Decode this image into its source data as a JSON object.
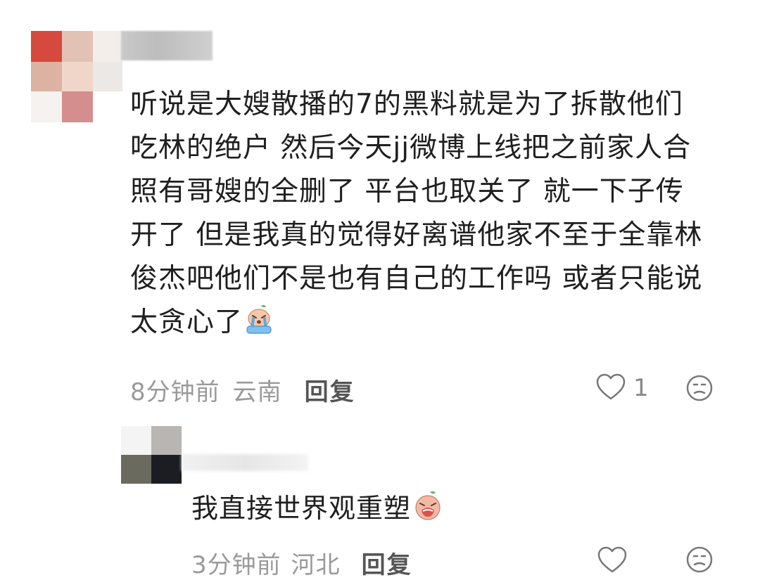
{
  "comments": [
    {
      "lines": [
        "听说是大嫂散播的7的黑料就是为了拆散他们",
        "吃林的绝户 然后今天jj微博上线把之前家人合",
        "照有哥嫂的全删了 平台也取关了 就一下子传",
        "开了 但是我真的觉得好离谱他家不至于全靠林",
        "俊杰吧他们不是也有自己的工作吗 或者只能说",
        "太贪心了"
      ],
      "emoji": "crying-face-emoji",
      "time": "8分钟前",
      "location": "云南",
      "reply_label": "回复",
      "like_count": "1"
    },
    {
      "text": "我直接世界观重塑",
      "emoji": "crying-face-emoji",
      "time": "3分钟前",
      "location": "河北",
      "reply_label": "回复"
    }
  ],
  "icons": {
    "like": "heart-outline-icon",
    "dislike": "frown-face-icon"
  },
  "colors": {
    "text": "#1f1f1f",
    "meta": "#9a9a9a",
    "reply": "#555555",
    "icon": "#777777"
  }
}
